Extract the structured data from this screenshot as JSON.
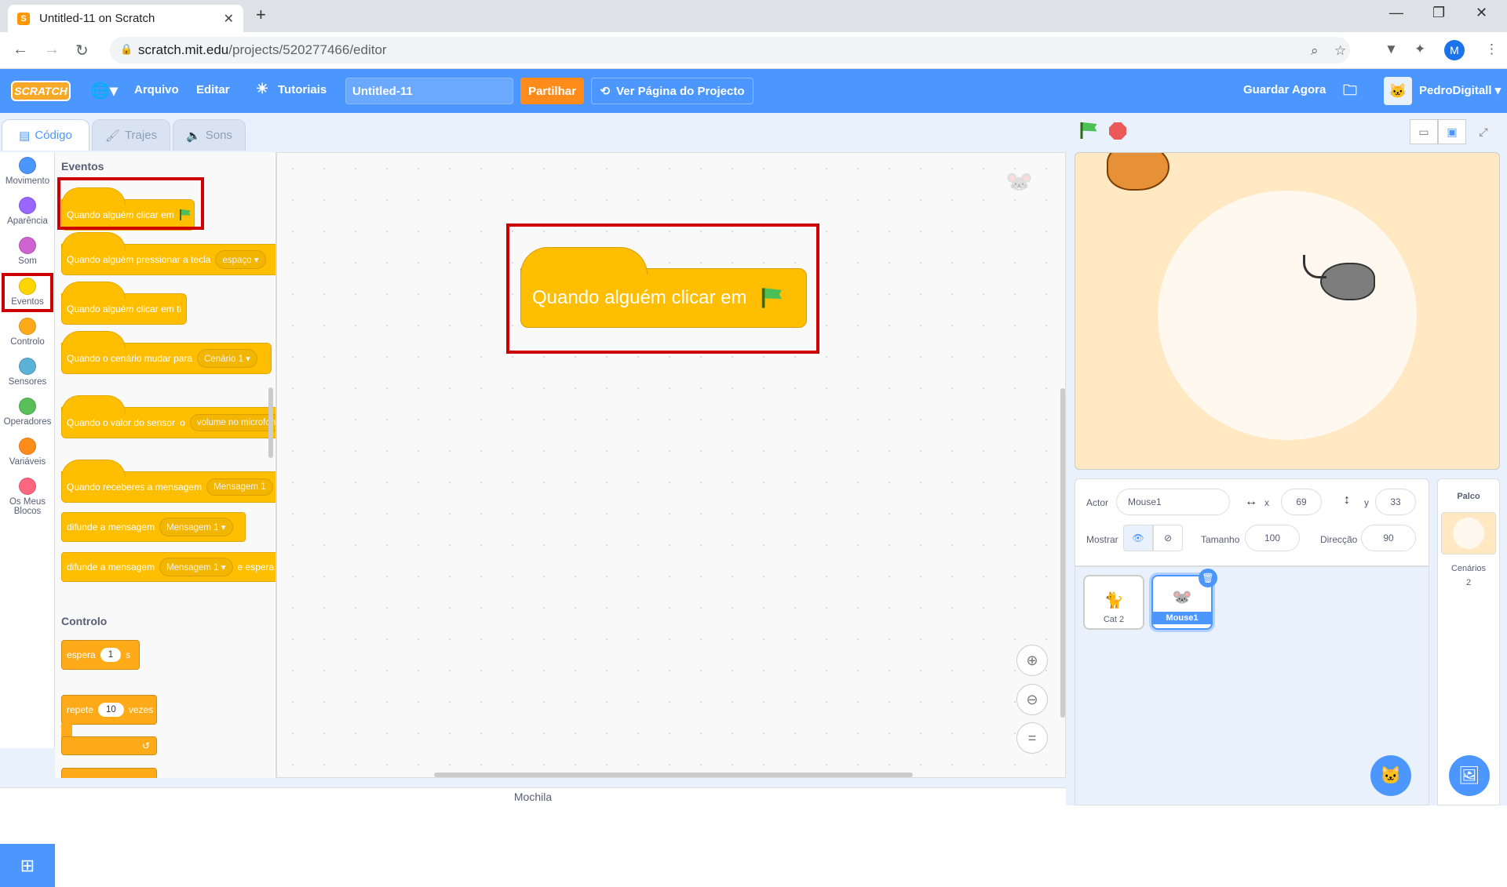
{
  "browser": {
    "tab_title": "Untitled-11 on Scratch",
    "url_host": "scratch.mit.edu",
    "url_path": "/projects/520277466/editor",
    "profile_initial": "M"
  },
  "menu": {
    "logo": "SCRATCH",
    "file": "Arquivo",
    "edit": "Editar",
    "tutorials": "Tutoriais",
    "project_title": "Untitled-11",
    "share": "Partilhar",
    "see_project": "Ver Página do Projecto",
    "save_now": "Guardar Agora",
    "username": "PedroDigitall"
  },
  "tabs": {
    "code": "Código",
    "costumes": "Trajes",
    "sounds": "Sons"
  },
  "categories": [
    {
      "label": "Movimento",
      "color": "#4c97ff"
    },
    {
      "label": "Aparência",
      "color": "#9966ff"
    },
    {
      "label": "Som",
      "color": "#cf63cf"
    },
    {
      "label": "Eventos",
      "color": "#ffd500"
    },
    {
      "label": "Controlo",
      "color": "#ffab19"
    },
    {
      "label": "Sensores",
      "color": "#5cb1d6"
    },
    {
      "label": "Operadores",
      "color": "#59c059"
    },
    {
      "label": "Variáveis",
      "color": "#ff8c1a"
    },
    {
      "label": "Os Meus Blocos",
      "color": "#ff6680"
    }
  ],
  "palette": {
    "events_title": "Eventos",
    "when_flag": "Quando alguém clicar em",
    "when_key": "Quando alguém pressionar a tecla",
    "key_value": "espaço",
    "when_clicked": "Quando alguém clicar em ti",
    "when_backdrop": "Quando o cenário mudar para",
    "backdrop_value": "Cenário 1",
    "when_sensor": "Quando o valor do sensor",
    "sensor_value": "volume no microfone",
    "when_receive": "Quando receberes a mensagem",
    "msg_value": "Mensagem 1",
    "broadcast": "difunde a mensagem",
    "broadcast_wait_suffix": "e espera",
    "control_title": "Controlo",
    "wait": "espera",
    "wait_value": "1",
    "wait_unit": "s",
    "repeat": "repete",
    "repeat_value": "10",
    "repeat_unit": "vezes"
  },
  "workspace": {
    "block_text": "Quando alguém clicar em"
  },
  "backpack": "Mochila",
  "sprite_info": {
    "actor_label": "Actor",
    "actor_name": "Mouse1",
    "x_label": "x",
    "x": "69",
    "y_label": "y",
    "y": "33",
    "show_label": "Mostrar",
    "size_label": "Tamanho",
    "size": "100",
    "direction_label": "Direcção",
    "direction": "90"
  },
  "sprites": [
    {
      "name": "Cat 2"
    },
    {
      "name": "Mouse1"
    }
  ],
  "stage_panel": {
    "title": "Palco",
    "backdrops_label": "Cenários",
    "backdrops_count": "2"
  },
  "accent": "#4c97ff"
}
